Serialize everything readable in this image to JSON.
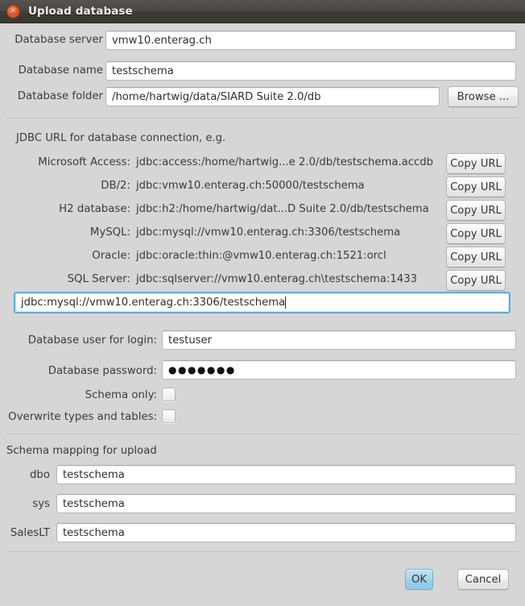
{
  "window": {
    "title": "Upload database",
    "close_icon": "close-icon",
    "close_glyph": "×"
  },
  "form": {
    "server": {
      "label": "Database server",
      "value": "vmw10.enterag.ch"
    },
    "name": {
      "label": "Database name",
      "value": "testschema"
    },
    "folder": {
      "label": "Database folder",
      "value": "/home/hartwig/data/SIARD Suite 2.0/db",
      "browse_label": "Browse ..."
    }
  },
  "jdbc": {
    "heading": "JDBC URL for database connection, e.g.",
    "copy_label": "Copy URL",
    "rows": [
      {
        "label": "Microsoft Access:",
        "url": "jdbc:access:/home/hartwig...e 2.0/db/testschema.accdb"
      },
      {
        "label": "DB/2:",
        "url": "jdbc:vmw10.enterag.ch:50000/testschema"
      },
      {
        "label": "H2 database:",
        "url": "jdbc:h2:/home/hartwig/dat...D Suite 2.0/db/testschema"
      },
      {
        "label": "MySQL:",
        "url": "jdbc:mysql://vmw10.enterag.ch:3306/testschema"
      },
      {
        "label": "Oracle:",
        "url": "jdbc:oracle:thin:@vmw10.enterag.ch:1521:orcl"
      },
      {
        "label": "SQL Server:",
        "url": "jdbc:sqlserver://vmw10.enterag.ch\\testschema:1433"
      }
    ],
    "editable_url": "jdbc:mysql://vmw10.enterag.ch:3306/testschema"
  },
  "credentials": {
    "user": {
      "label": "Database user for login:",
      "value": "testuser"
    },
    "password": {
      "label": "Database password:",
      "value": "●●●●●●●"
    },
    "schema_only": {
      "label": "Schema only:",
      "checked": false
    },
    "overwrite_types": {
      "label": "Overwrite types and tables:",
      "checked": false
    }
  },
  "schema_mapping": {
    "heading": "Schema mapping for upload",
    "rows": [
      {
        "label": "dbo",
        "value": "testschema"
      },
      {
        "label": "sys",
        "value": "testschema"
      },
      {
        "label": "SalesLT",
        "value": "testschema"
      }
    ]
  },
  "actions": {
    "ok": "OK",
    "cancel": "Cancel"
  },
  "colors": {
    "titlebar": "#453F3B",
    "close": "#E2572C",
    "window_bg": "#D6D6D6",
    "focus_border": "#5AAEDB",
    "primary_button": "#A8D6EE"
  }
}
